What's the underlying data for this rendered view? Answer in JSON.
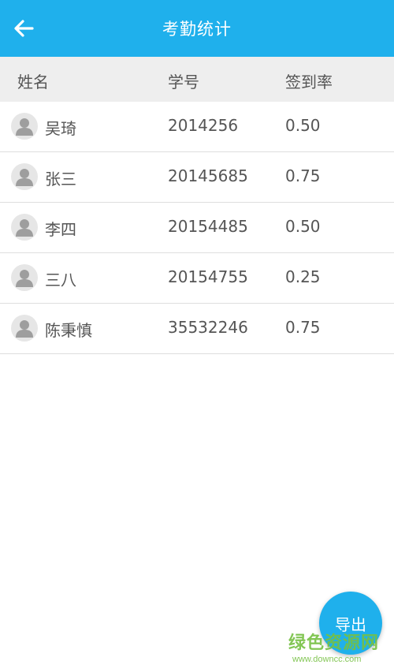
{
  "header": {
    "title": "考勤统计",
    "back_icon": "arrow-left-icon"
  },
  "columns": {
    "name": "姓名",
    "id": "学号",
    "rate": "签到率"
  },
  "rows": [
    {
      "name": "吴琦",
      "id": "2014256",
      "rate": "0.50"
    },
    {
      "name": "张三",
      "id": "20145685",
      "rate": "0.75"
    },
    {
      "name": "李四",
      "id": "20154485",
      "rate": "0.50"
    },
    {
      "name": "三八",
      "id": "20154755",
      "rate": "0.25"
    },
    {
      "name": "陈秉慎",
      "id": "35532246",
      "rate": "0.75"
    }
  ],
  "fab": {
    "label": "导出"
  },
  "watermark": {
    "title": "绿色资源网",
    "url": "www.downcc.com"
  },
  "colors": {
    "primary": "#1fb0ec",
    "header_band": "#eeeeee",
    "watermark": "#76c043"
  }
}
